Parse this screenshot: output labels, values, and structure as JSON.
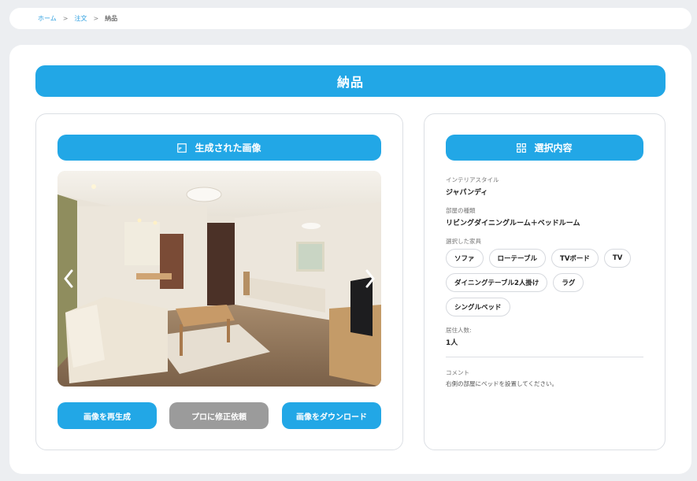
{
  "breadcrumb": {
    "home": "ホーム",
    "order": "注文",
    "current": "納品",
    "separator": ">"
  },
  "page": {
    "title": "納品"
  },
  "left_panel": {
    "header": "生成された画像",
    "header_icon": "image-frame-icon",
    "image_alt": "generated-room-render",
    "buttons": {
      "regenerate": "画像を再生成",
      "pro_fix": "プロに修正依頼",
      "download": "画像をダウンロード"
    }
  },
  "right_panel": {
    "header": "選択内容",
    "header_icon": "grid-icon",
    "interior_style_label": "インテリアスタイル",
    "interior_style_value": "ジャパンディ",
    "room_type_label": "部屋の種類",
    "room_type_value": "リビングダイニングルーム＋ベッドルーム",
    "furniture_label": "選択した家具",
    "furniture": [
      "ソファ",
      "ローテーブル",
      "TVボード",
      "TV",
      "ダイニングテーブル2人掛け",
      "ラグ",
      "シングルベッド"
    ],
    "residents_label": "居住人数:",
    "residents_value": "1人",
    "comment_label": "コメント",
    "comment_value": "右側の部屋にベッドを設置してください。"
  },
  "colors": {
    "accent": "#22a7e6",
    "secondary_button": "#9b9b9b",
    "background": "#eceef1"
  }
}
